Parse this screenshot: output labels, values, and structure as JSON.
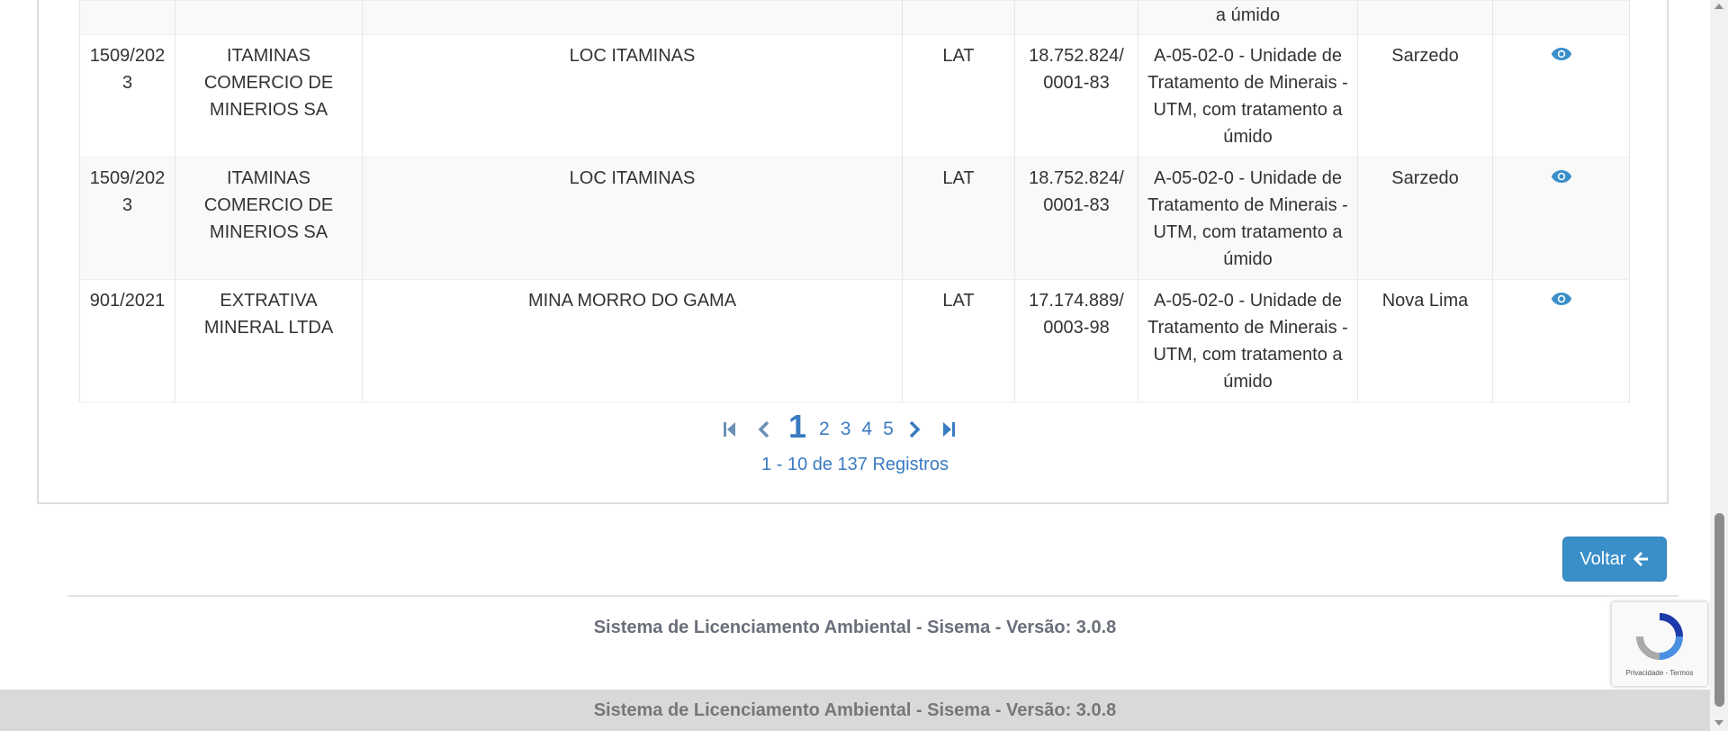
{
  "table": {
    "rows": [
      {
        "proc": "",
        "empreendedor": "",
        "empreendimento": "",
        "modalidade": "",
        "cnpj": "",
        "atividade": "a úmido",
        "municipio": ""
      },
      {
        "proc": "1509/2023",
        "empreendedor": "ITAMINAS COMERCIO DE MINERIOS SA",
        "empreendimento": "LOC ITAMINAS",
        "modalidade": "LAT",
        "cnpj": "18.752.824/ 0001-83",
        "atividade": "A-05-02-0 - Unidade de Tratamento de Minerais - UTM, com tratamento a úmido",
        "municipio": "Sarzedo"
      },
      {
        "proc": "1509/2023",
        "empreendedor": "ITAMINAS COMERCIO DE MINERIOS SA",
        "empreendimento": "LOC ITAMINAS",
        "modalidade": "LAT",
        "cnpj": "18.752.824/ 0001-83",
        "atividade": "A-05-02-0 - Unidade de Tratamento de Minerais - UTM, com tratamento a úmido",
        "municipio": "Sarzedo"
      },
      {
        "proc": "901/2021",
        "empreendedor": "EXTRATIVA MINERAL LTDA",
        "empreendimento": "MINA MORRO DO GAMA",
        "modalidade": "LAT",
        "cnpj": "17.174.889/ 0003-98",
        "atividade": "A-05-02-0 - Unidade de Tratamento de Minerais - UTM, com tratamento a úmido",
        "municipio": "Nova Lima"
      }
    ],
    "row_icon": "eye-icon"
  },
  "pagination": {
    "pages": [
      "1",
      "2",
      "3",
      "4",
      "5"
    ],
    "current": "1",
    "summary": "1 - 10 de 137 Registros"
  },
  "back_button": {
    "label": "Voltar",
    "icon": "arrow-left-icon"
  },
  "footer": {
    "text": "Sistema de Licenciamento Ambiental - Sisema - Versão: 3.0.8",
    "bar_text": "Sistema de Licenciamento Ambiental - Sisema - Versão: 3.0.8"
  },
  "recaptcha": {
    "label": "Privacidade - Termos"
  },
  "colors": {
    "accent": "#3a8fc9",
    "link": "#3a7bc2",
    "footer_bar": "#d9d9d9"
  }
}
